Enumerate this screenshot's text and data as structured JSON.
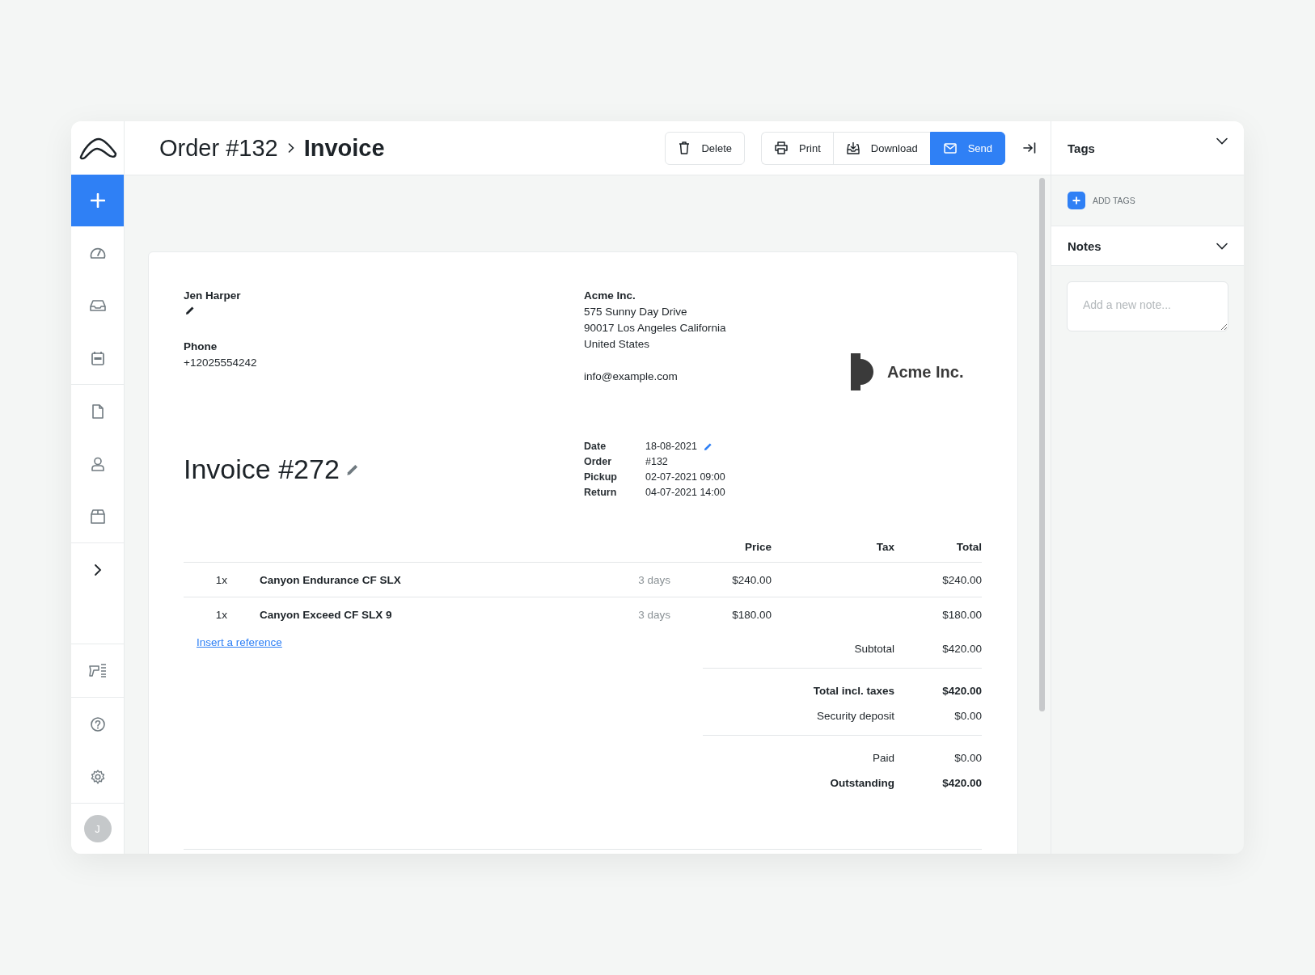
{
  "header": {
    "breadcrumb": [
      {
        "text": "Order **#132**"
      },
      {
        "text": "Invoice"
      }
    ],
    "actions": [
      {
        "label": "Delete",
        "kind": "single"
      },
      {
        "label": "Print",
        "kind": "group"
      },
      {
        "label": "Download",
        "kind": "group"
      },
      {
        "label": "Send",
        "kind": "primary"
      }
    ]
  },
  "invoice": {
    "customer": {
      "name": "Jen Harper",
      "phone_label": "Phone",
      "phone": "+12025554242"
    },
    "company": {
      "lines": [
        "Acme Inc.",
        "575 Sunny Day Drive",
        "90017 Los Angeles California",
        "United States"
      ],
      "email": "info@example.com",
      "logo_text": "Acme Inc."
    },
    "title": "Invoice **#272**",
    "details": [
      {
        "label": "Date",
        "value": "18-08-2021",
        "editable": true
      },
      {
        "label": "Order",
        "value": "#132",
        "editable": false
      },
      {
        "label": "Pickup",
        "value": "02-07-2021 09:00",
        "editable": false
      },
      {
        "label": "Return",
        "value": "04-07-2021 14:00",
        "editable": false
      }
    ],
    "columns": [
      "Price",
      "Tax",
      "Total"
    ],
    "lines": [
      {
        "qty": "1x",
        "name": "Canyon Endurance CF SLX",
        "duration": "3 days",
        "price": "$240.00",
        "total": "$240.00"
      },
      {
        "qty": "1x",
        "name": "Canyon Exceed CF SLX 9",
        "duration": "3 days",
        "price": "$180.00",
        "total": "$180.00"
      }
    ],
    "reference_link": "Insert a reference",
    "totals": [
      [
        {
          "label": "Subtotal",
          "value": "$420.00",
          "bold": false
        }
      ],
      [
        {
          "label": "Total incl. taxes",
          "value": "$420.00",
          "bold": true
        },
        {
          "label": "Security deposit",
          "value": "$0.00",
          "bold": false
        }
      ],
      [
        {
          "label": "Paid",
          "value": "$0.00",
          "bold": false
        },
        {
          "label": "Outstanding",
          "value": "$420.00",
          "bold": true
        }
      ]
    ]
  },
  "sidebar": {
    "avatar": "J"
  },
  "panel": {
    "tags": {
      "title": "Tags",
      "action": "ADD TAGS"
    },
    "notes": {
      "title": "Notes",
      "placeholder": "Add a new note..."
    }
  }
}
